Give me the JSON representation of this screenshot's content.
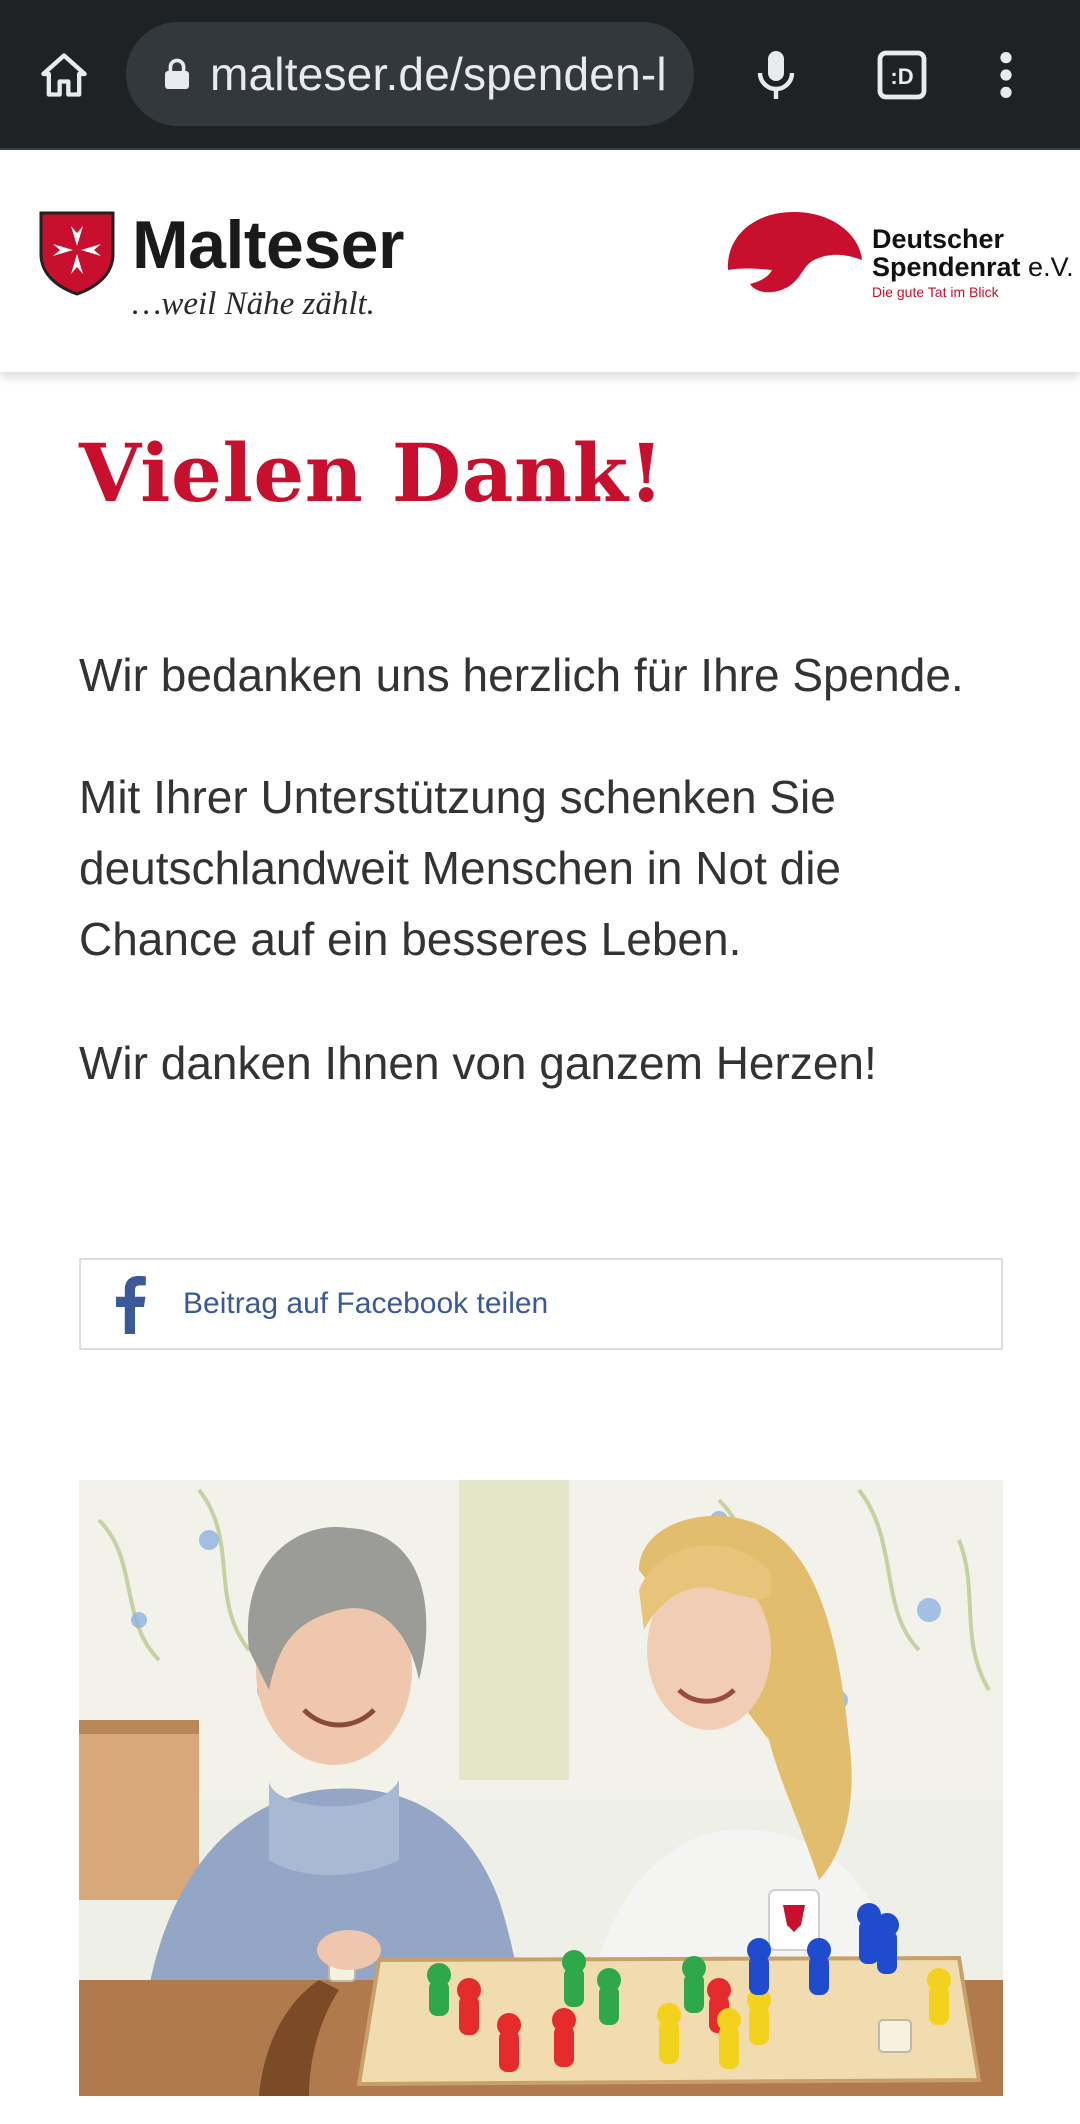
{
  "browser": {
    "url": "malteser.de/spenden-l",
    "icons": [
      "home-icon",
      "lock-icon",
      "microphone-icon",
      "tab-switcher-icon",
      "more-vert-icon"
    ],
    "tabs_label": ":D"
  },
  "header": {
    "brand_name": "Malteser",
    "brand_tagline": "…weil Nähe zählt.",
    "partner_line1": "Deutscher",
    "partner_line2": "Spendenrat",
    "partner_suffix": "e.V.",
    "partner_tagline": "Die gute Tat im Blick"
  },
  "main": {
    "title": "Vielen Dank!",
    "paragraph1": "Wir bedanken uns herzlich für Ihre Spende.",
    "paragraph2": "Mit Ihrer Unterstützung schenken Sie deutschlandweit Menschen in Not die Chance auf ein besseres Leben.",
    "paragraph3": "Wir danken Ihnen von ganzem Herzen!",
    "share_label": "Beitrag auf Facebook teilen"
  },
  "colors": {
    "accent_red": "#c8102e",
    "facebook_blue": "#3b5998",
    "browser_bg": "#1f2224"
  }
}
